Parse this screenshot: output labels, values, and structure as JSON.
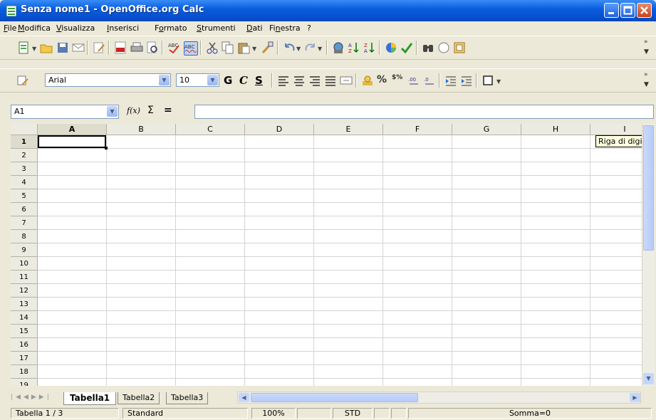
{
  "window": {
    "title": "Senza nome1 - OpenOffice.org Calc"
  },
  "menu": [
    "File",
    "Modifica",
    "Visualizza",
    "Inserisci",
    "Formato",
    "Strumenti",
    "Dati",
    "Finestra",
    "?"
  ],
  "menu_accel": [
    "F",
    "M",
    "V",
    "I",
    "o",
    "S",
    "D",
    "n",
    "?"
  ],
  "format_toolbar": {
    "font_name": "Arial",
    "font_size": "10",
    "bold": "G",
    "italic": "C",
    "underline": "S"
  },
  "formula_bar": {
    "cell_ref": "A1",
    "fx": "f(x)",
    "sum": "Σ",
    "equals": "=",
    "content": ""
  },
  "columns": [
    "A",
    "B",
    "C",
    "D",
    "E",
    "F",
    "G",
    "H",
    "I"
  ],
  "rows": [
    "1",
    "2",
    "3",
    "4",
    "5",
    "6",
    "7",
    "8",
    "9",
    "10",
    "11",
    "12",
    "13",
    "14",
    "15",
    "16",
    "17",
    "18",
    "19"
  ],
  "selected_cell": "A1",
  "tooltip": "Riga di digitazione",
  "sheet_tabs": [
    "Tabella1",
    "Tabella2",
    "Tabella3"
  ],
  "active_sheet": "Tabella1",
  "status": {
    "sheet": "Tabella 1 / 3",
    "style": "Standard",
    "zoom": "100%",
    "mode": "STD",
    "sum": "Somma=0"
  },
  "icons": {
    "app": "calc-spreadsheet-icon",
    "toolbar": [
      "new-document-icon",
      "open-folder-icon",
      "save-icon",
      "email-icon",
      "edit-file-icon",
      "export-pdf-icon",
      "print-icon",
      "page-preview-icon",
      "spellcheck-icon",
      "autospellcheck-icon",
      "cut-icon",
      "copy-icon",
      "paste-icon",
      "format-paintbrush-icon",
      "undo-icon",
      "redo-icon",
      "hyperlink-icon",
      "sort-ascending-icon",
      "sort-descending-icon",
      "chart-icon",
      "show-draw-functions-icon",
      "find-replace-icon",
      "navigator-icon",
      "gallery-icon"
    ]
  },
  "colors": {
    "title_blue": "#0a5fe0",
    "chrome": "#ece9d8",
    "grid": "#d4d4d4"
  }
}
